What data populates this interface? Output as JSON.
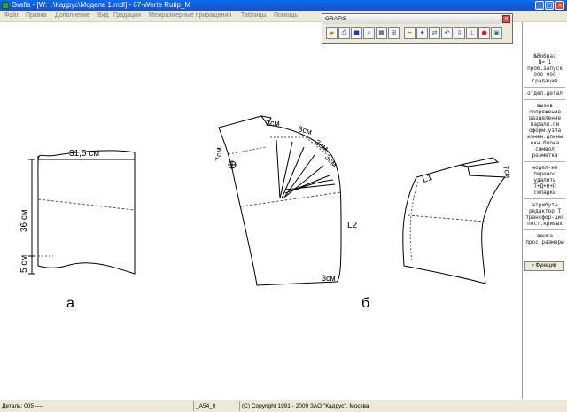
{
  "window": {
    "title": "Grafis - [W: ..\\Кадрус\\Модель 1.mdl] - 67-Werte Rutip_M"
  },
  "menu": [
    "Файл",
    "Правка",
    "Дополнение",
    "Вид",
    "Градация",
    "Межразмерные приращения",
    "Таблицы",
    "Помощь"
  ],
  "toolbar": {
    "title": "GRAFIS"
  },
  "sidebar": {
    "header": [
      "№Вобраз",
      "N= 1",
      "проб.запуск",
      "000 000",
      "градация"
    ],
    "group1": [
      "отдел.детал"
    ],
    "group2": [
      "вызов",
      "сопряжение",
      "разделение",
      "паралл.пи",
      "оформ.узла",
      "измен.длины",
      "окн.блока",
      "символ",
      "разметка"
    ],
    "group3": [
      "модел-ие",
      "перенос",
      "удалить",
      "Т+Д+О+П",
      "складки"
    ],
    "group4": [
      "атрибуты",
      "редактор Т",
      "трансфор-ция",
      "пост.кривых"
    ],
    "group5": [
      "вешка",
      "прос.размеры"
    ],
    "func_button": "‹ Функции"
  },
  "drawing": {
    "a": {
      "label": "а",
      "width_dim": "31,5 см",
      "height_dim": "36 см",
      "bottom_dim": "5 см"
    },
    "b": {
      "label": "б",
      "dims": [
        "3см",
        "3см",
        "3см",
        "3см",
        "7см",
        "3см"
      ],
      "curve_label": "L2"
    },
    "c": {
      "curve_label": "L1",
      "dim": "7см"
    }
  },
  "status": {
    "part": "Деталь: 005 ----",
    "size": "_A54_0",
    "copyright": "(C) Copyright 1991 - 2009 ЗАО \"Кадрус\", Москва"
  }
}
